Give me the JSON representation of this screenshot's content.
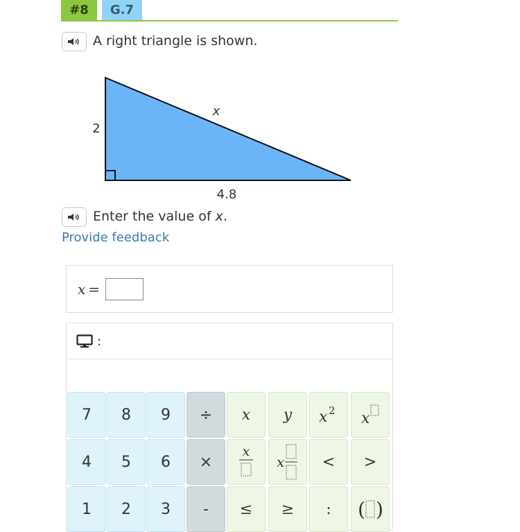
{
  "header": {
    "question_number": "#8",
    "skill_code": "G.7"
  },
  "icons": {
    "speaker": "speaker-icon",
    "monitor": "monitor-icon",
    "placeholder": "dotted-box-icon"
  },
  "colors": {
    "green": "#8dc63f",
    "blue_badge": "#8fd3f7",
    "triangle_fill": "#6cb4f8",
    "link": "#3b7ab3"
  },
  "question": {
    "intro": "A right triangle is shown.",
    "instruction_prefix": "Enter the value of ",
    "instruction_var": "x",
    "instruction_suffix": ".",
    "feedback_link": "Provide feedback"
  },
  "figure": {
    "left_side": "2",
    "base": "4.8",
    "hypotenuse": "x"
  },
  "answer": {
    "variable": "x",
    "equals": "=",
    "value": ""
  },
  "keypad": {
    "header_colon": ":",
    "row1": [
      "7",
      "8",
      "9",
      "÷",
      "x",
      "y",
      "x²",
      "x^□"
    ],
    "row2": [
      "4",
      "5",
      "6",
      "×",
      "x/□",
      "x□/□",
      "<",
      ">"
    ],
    "row3": [
      "1",
      "2",
      "3",
      "-",
      "≤",
      "≥",
      ":",
      "(□)"
    ]
  }
}
